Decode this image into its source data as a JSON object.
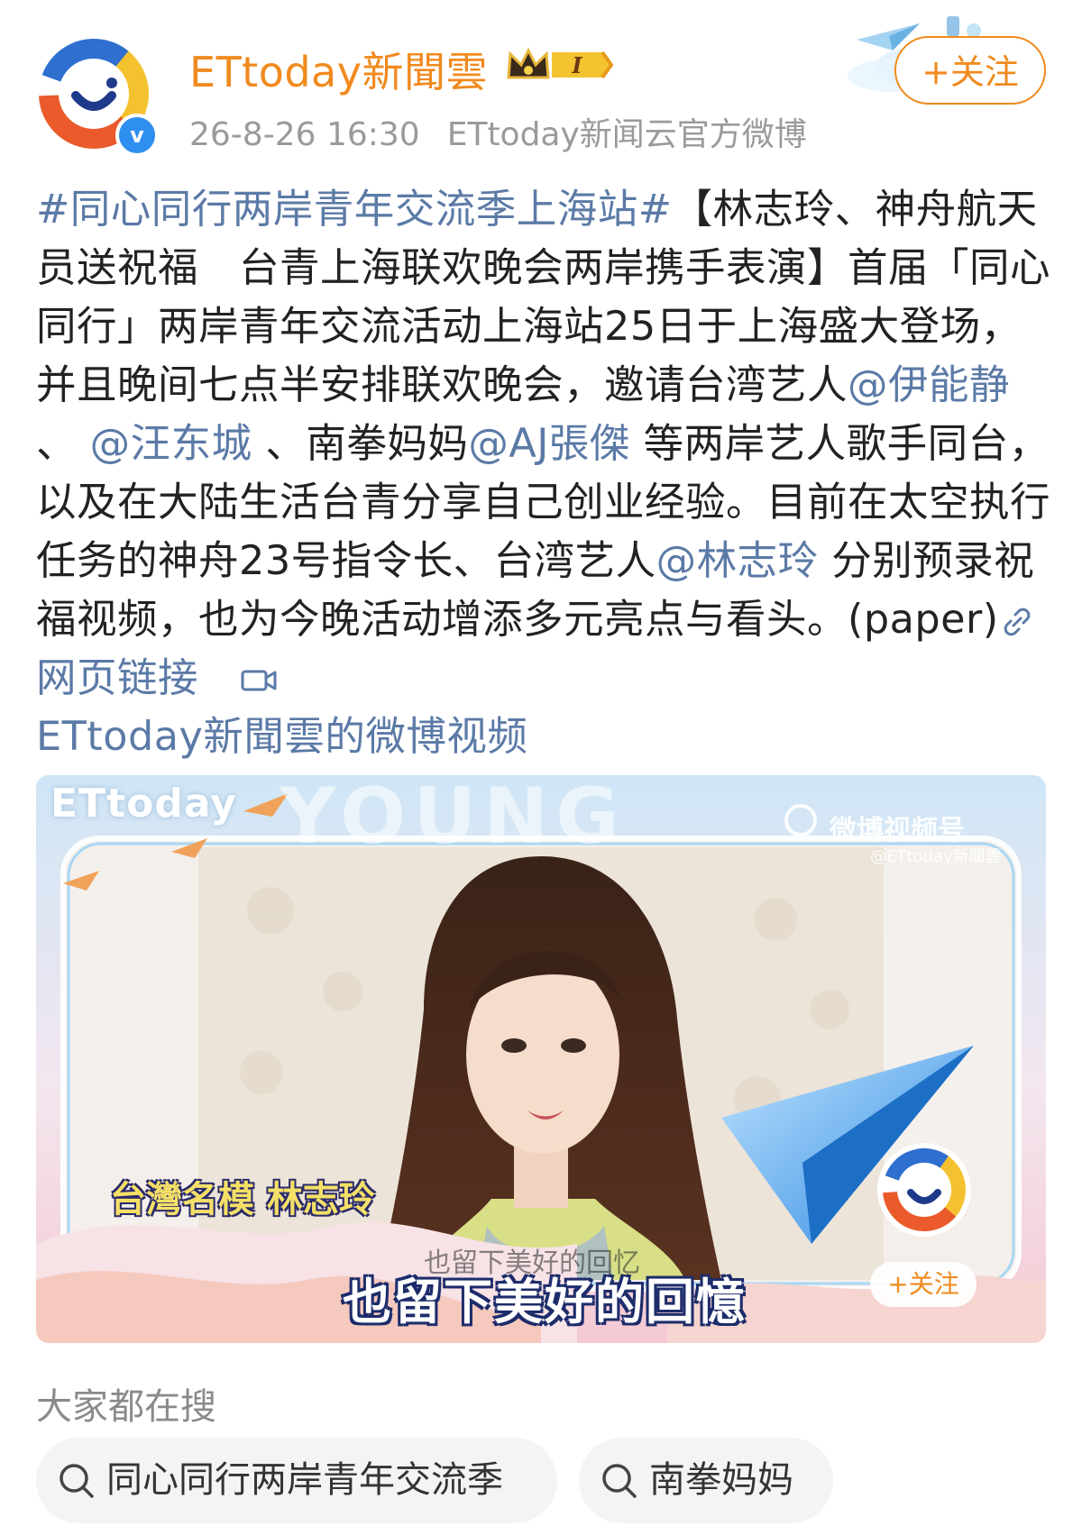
{
  "header": {
    "user_name": "ETtoday新聞雲",
    "badge_level": "I",
    "timestamp": "26-8-26 16:30",
    "source": "ETtoday新闻云官方微博",
    "follow_label": "+关注",
    "verified_mark": "v"
  },
  "post": {
    "hashtag": "#同心同行两岸青年交流季上海站#",
    "text_1": "【林志玲、神舟航天员送祝福　台青上海联欢晚会两岸携手表演】首届「同心同行」两岸青年交流活动上海站25日于上海盛大登场，并且晚间七点半安排联欢晚会，邀请台湾艺人",
    "mention_1": "@伊能静",
    "sep_1": " 、",
    "mention_2": "@汪东城",
    "sep_2": " 、南拳妈妈",
    "mention_3": "@AJ張傑",
    "text_2": " 等两岸艺人歌手同台，以及在大陆生活台青分享自己创业经验。目前在太空执行任务的神舟23号指令长、台湾艺人",
    "mention_4": "@林志玲",
    "text_3": " 分别预录祝福视频，也为今晚活动增添多元亮点与看头。(paper)",
    "web_link_label": "网页链接",
    "video_link_label": "ETtoday新聞雲的微博视频"
  },
  "video": {
    "channel_logo_text": "ETtoday",
    "banner_text": "YOUNG",
    "watermark_1": "微博视频号",
    "watermark_2": "@ETtoday新聞雲",
    "caption_name": "台灣名模 林志玲",
    "subtitle_faint": "也留下美好的回忆",
    "subtitle_main": "也留下美好的回憶",
    "follow_label": "+关注"
  },
  "search": {
    "title": "大家都在搜",
    "chips": [
      "同心同行两岸青年交流季",
      "南拳妈妈"
    ]
  },
  "colors": {
    "accent_orange": "#f08a1f",
    "link_blue": "#5b7aa6",
    "verified_blue": "#2f8ff0"
  }
}
